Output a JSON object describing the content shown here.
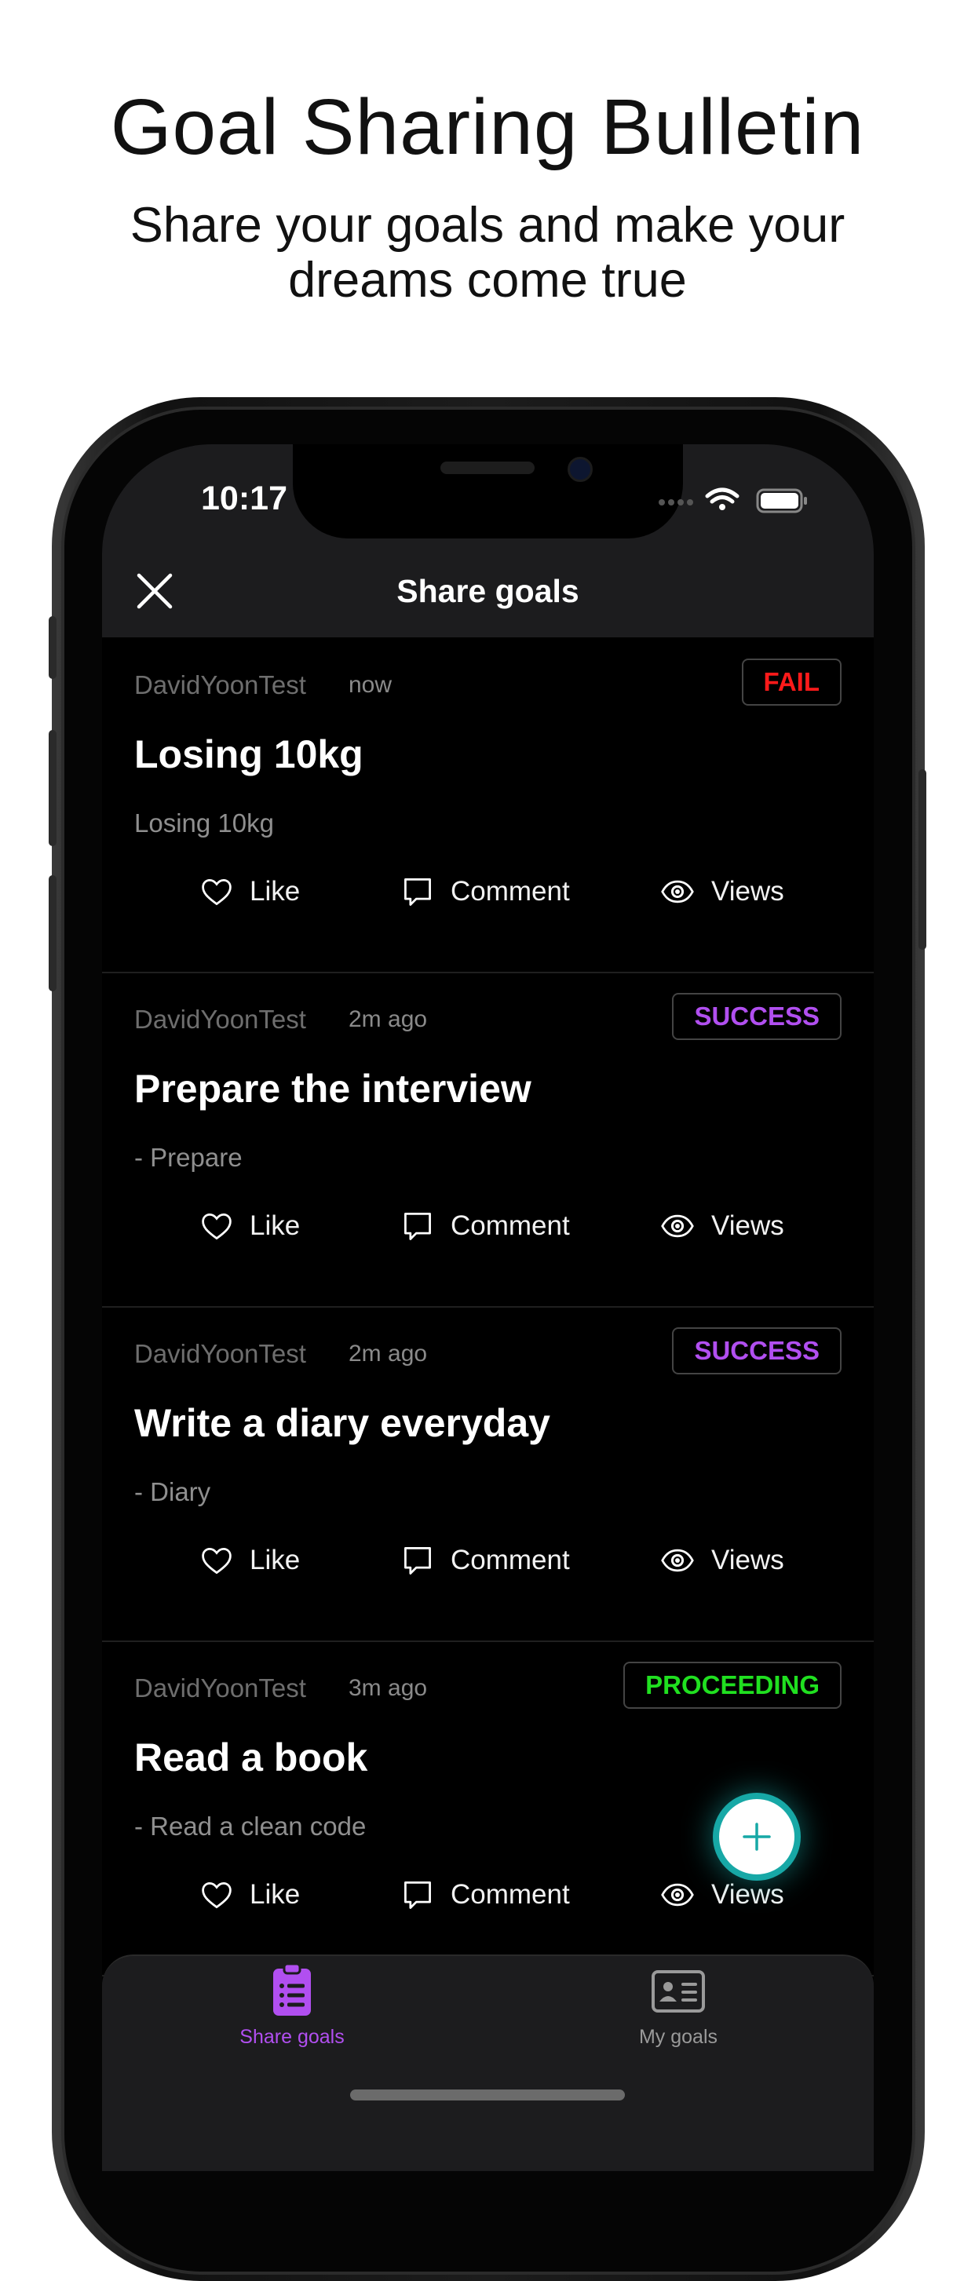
{
  "promo": {
    "headline": "Goal Sharing Bulletin",
    "subline": "Share your goals and make your dreams come true"
  },
  "status_bar": {
    "time": "10:17"
  },
  "header": {
    "title": "Share goals"
  },
  "actions": {
    "like": "Like",
    "comment": "Comment",
    "views": "Views"
  },
  "posts": [
    {
      "author": "DavidYoonTest",
      "time": "now",
      "status": "FAIL",
      "status_color": "#ff1a1a",
      "title": "Losing 10kg",
      "desc": "Losing 10kg"
    },
    {
      "author": "DavidYoonTest",
      "time": "2m ago",
      "status": "SUCCESS",
      "status_color": "#b14ff0",
      "title": "Prepare the interview",
      "desc": "- Prepare"
    },
    {
      "author": "DavidYoonTest",
      "time": "2m ago",
      "status": "SUCCESS",
      "status_color": "#b14ff0",
      "title": "Write a diary everyday",
      "desc": "- Diary"
    },
    {
      "author": "DavidYoonTest",
      "time": "3m ago",
      "status": "PROCEEDING",
      "status_color": "#20e020",
      "title": "Read a book",
      "desc": "- Read a clean code"
    }
  ],
  "tabs": [
    {
      "label": "Share goals",
      "active": true,
      "color": "#b14ff0"
    },
    {
      "label": "My goals",
      "active": false,
      "color": "#9a9a9a"
    }
  ],
  "colors": {
    "accent": "#b14ff0",
    "fab": "#17a8a6"
  }
}
